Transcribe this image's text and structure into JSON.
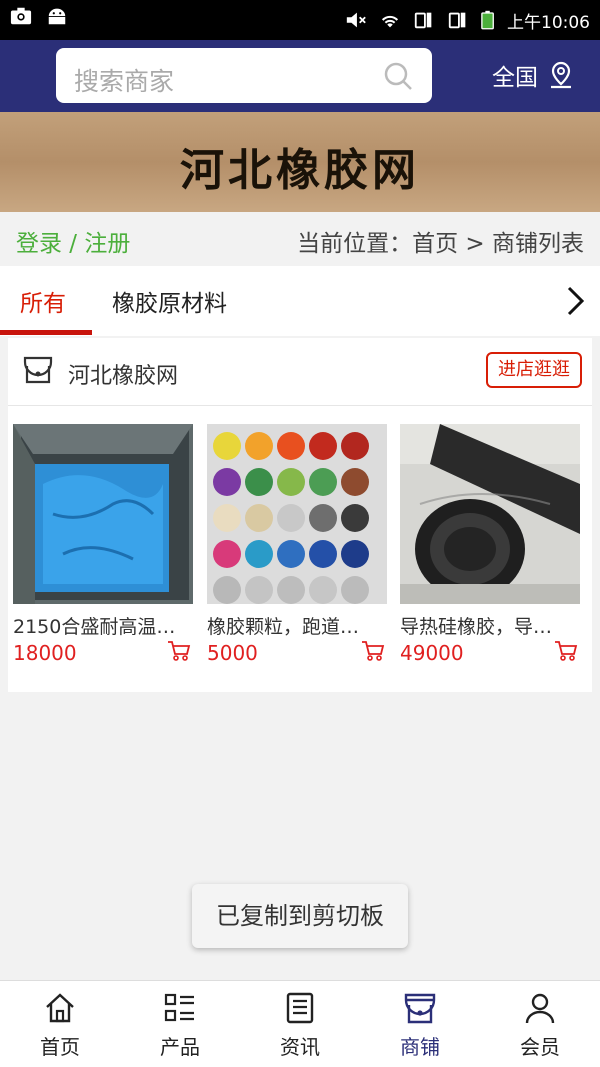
{
  "statusbar": {
    "time": "上午10:06"
  },
  "header": {
    "search_placeholder": "搜索商家",
    "region_label": "全国"
  },
  "banner": {
    "title": "河北橡胶网"
  },
  "locbar": {
    "login_label": "登录 / 注册",
    "breadcrumb": "当前位置：首页 > 商铺列表"
  },
  "tabs": [
    {
      "label": "所有"
    },
    {
      "label": "橡胶原材料"
    }
  ],
  "shop": {
    "name": "河北橡胶网",
    "enter_label": "进店逛逛",
    "products": [
      {
        "name": "2150合盛耐高温…",
        "price": "18000"
      },
      {
        "name": "橡胶颗粒，跑道…",
        "price": "5000"
      },
      {
        "name": "导热硅橡胶，导…",
        "price": "49000"
      }
    ]
  },
  "toast": {
    "text": "已复制到剪切板"
  },
  "bottom_nav": [
    {
      "label": "首页",
      "icon": "home-icon"
    },
    {
      "label": "产品",
      "icon": "grid-list-icon"
    },
    {
      "label": "资讯",
      "icon": "news-icon"
    },
    {
      "label": "商铺",
      "icon": "store-icon"
    },
    {
      "label": "会员",
      "icon": "user-icon"
    }
  ],
  "colors": {
    "header_bg": "#2b2f78",
    "accent_red": "#d81e06",
    "login_green": "#4caf3c",
    "price_red": "#e02020"
  }
}
